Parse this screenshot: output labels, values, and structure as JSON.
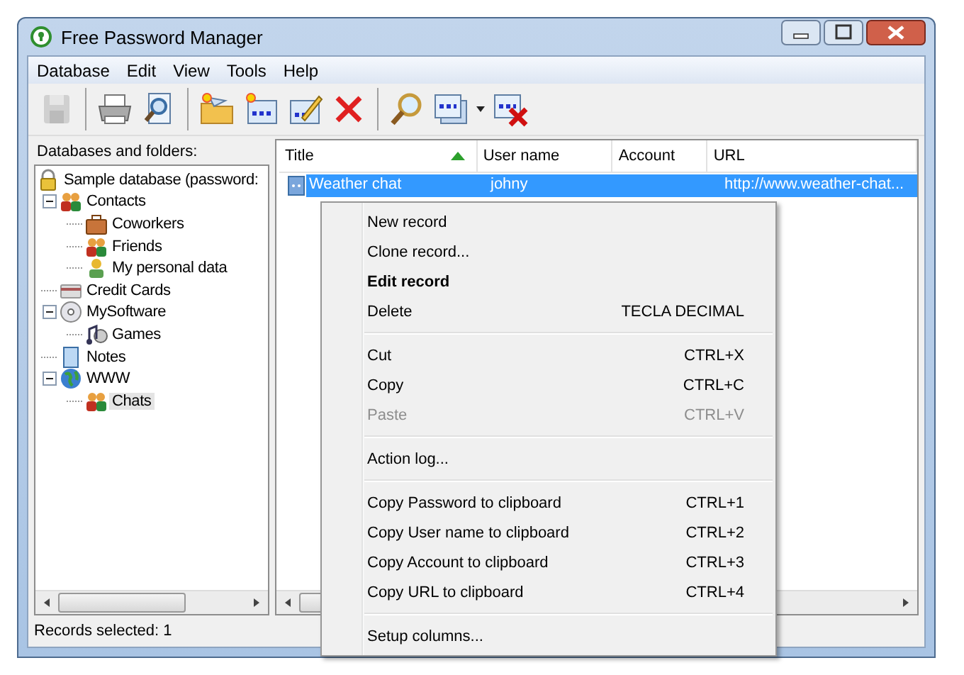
{
  "window": {
    "title": "Free Password Manager"
  },
  "menu_bar": [
    "Database",
    "Edit",
    "View",
    "Tools",
    "Help"
  ],
  "toolbar": [
    {
      "kind": "save",
      "disabled": true
    },
    {
      "kind": "sep"
    },
    {
      "kind": "print",
      "disabled": false
    },
    {
      "kind": "preview",
      "disabled": false
    },
    {
      "kind": "sep"
    },
    {
      "kind": "new-folder",
      "disabled": false
    },
    {
      "kind": "new-record",
      "disabled": false
    },
    {
      "kind": "edit",
      "disabled": false
    },
    {
      "kind": "delete",
      "disabled": false
    },
    {
      "kind": "sep"
    },
    {
      "kind": "find",
      "disabled": false
    },
    {
      "kind": "copy",
      "disabled": false
    },
    {
      "kind": "dropdown",
      "disabled": false
    },
    {
      "kind": "clear",
      "disabled": false
    }
  ],
  "sidebar": {
    "title": "Databases and folders:",
    "tree": [
      {
        "label": "Sample database (password:",
        "kind": "database",
        "selected": false,
        "children": [
          {
            "label": "Contacts",
            "kind": "group",
            "selected": false,
            "expanded": true,
            "children": [
              {
                "label": "Coworkers",
                "kind": "briefcase",
                "selected": false
              },
              {
                "label": "Friends",
                "kind": "group",
                "selected": false
              },
              {
                "label": "My personal data",
                "kind": "person",
                "selected": false
              }
            ]
          },
          {
            "label": "Credit Cards",
            "kind": "card",
            "selected": false
          },
          {
            "label": "MySoftware",
            "kind": "disc",
            "selected": false,
            "expanded": true,
            "children": [
              {
                "label": "Games",
                "kind": "music",
                "selected": false
              }
            ]
          },
          {
            "label": "Notes",
            "kind": "notes",
            "selected": false
          },
          {
            "label": "WWW",
            "kind": "globe",
            "selected": false,
            "expanded": true,
            "children": [
              {
                "label": "Chats",
                "kind": "group",
                "selected": true
              }
            ]
          }
        ]
      }
    ]
  },
  "table": {
    "columns": [
      {
        "label": "Title",
        "sorted": true
      },
      {
        "label": "User name",
        "sorted": false
      },
      {
        "label": "Account",
        "sorted": false
      },
      {
        "label": "URL",
        "sorted": false
      }
    ],
    "rows": [
      {
        "selected": true,
        "cells": [
          "Weather chat",
          "johny",
          "",
          "http://www.weather-chat..."
        ]
      }
    ]
  },
  "context_menu": [
    {
      "kind": "item",
      "label": "New record",
      "default": false,
      "disabled": false
    },
    {
      "kind": "item",
      "label": "Clone record...",
      "default": false,
      "disabled": false
    },
    {
      "kind": "item",
      "label": "Edit record",
      "default": true,
      "disabled": false
    },
    {
      "kind": "item",
      "label": "Delete",
      "shortcut": "TECLA DECIMAL",
      "default": false,
      "disabled": false
    },
    {
      "kind": "separator"
    },
    {
      "kind": "item",
      "label": "Cut",
      "shortcut": "CTRL+X",
      "default": false,
      "disabled": false
    },
    {
      "kind": "item",
      "label": "Copy",
      "shortcut": "CTRL+C",
      "default": false,
      "disabled": false
    },
    {
      "kind": "item",
      "label": "Paste",
      "shortcut": "CTRL+V",
      "default": false,
      "disabled": true
    },
    {
      "kind": "separator"
    },
    {
      "kind": "item",
      "label": "Action log...",
      "default": false,
      "disabled": false
    },
    {
      "kind": "separator"
    },
    {
      "kind": "item",
      "label": "Copy Password to clipboard",
      "shortcut": "CTRL+1",
      "default": false,
      "disabled": false
    },
    {
      "kind": "item",
      "label": "Copy User name to clipboard",
      "shortcut": "CTRL+2",
      "default": false,
      "disabled": false
    },
    {
      "kind": "item",
      "label": "Copy Account to clipboard",
      "shortcut": "CTRL+3",
      "default": false,
      "disabled": false
    },
    {
      "kind": "item",
      "label": "Copy URL to clipboard",
      "shortcut": "CTRL+4",
      "default": false,
      "disabled": false
    },
    {
      "kind": "separator"
    },
    {
      "kind": "item",
      "label": "Setup columns...",
      "default": false,
      "disabled": false
    }
  ],
  "status_bar": "Records selected: 1"
}
